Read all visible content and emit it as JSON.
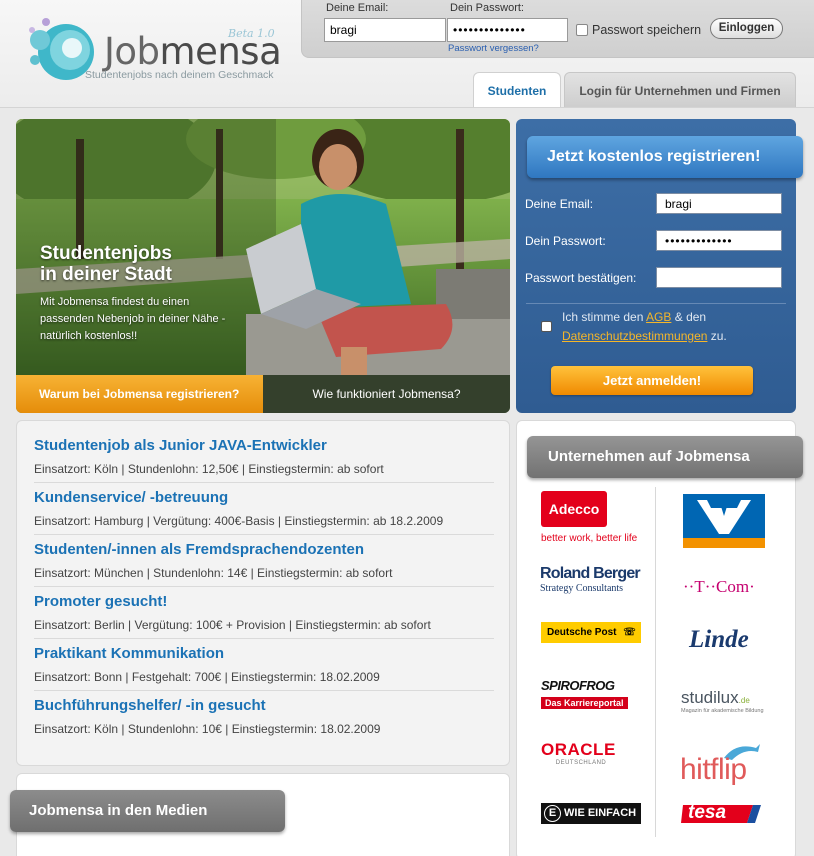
{
  "brand": {
    "name_part1": "Job",
    "name_part2": "mensa",
    "beta": "Beta 1.0",
    "tagline": "Studentenjobs nach deinem Geschmack"
  },
  "login": {
    "email_label": "Deine Email:",
    "email_value": "bragi",
    "password_label": "Dein Passwort:",
    "password_value": "••••••••••••••",
    "forgot": "Passwort vergessen?",
    "remember": "Passwort speichern",
    "submit": "Einloggen"
  },
  "tabs": [
    {
      "label": "Studenten",
      "active": true
    },
    {
      "label": "Login für Unternehmen und Firmen",
      "active": false
    }
  ],
  "hero": {
    "title_line1": "Studentenjobs",
    "title_line2": "in deiner Stadt",
    "text": "Mit Jobmensa findest du einen passenden Nebenjob in deiner Nähe - natürlich kostenlos!!",
    "btn_why": "Warum bei Jobmensa registrieren?",
    "btn_how": "Wie funktioniert Jobmensa?"
  },
  "register": {
    "banner": "Jetzt kostenlos registrieren!",
    "email_label": "Deine Email:",
    "email_value": "bragi",
    "password_label": "Dein Passwort:",
    "password_value": "•••••••••••••",
    "confirm_label": "Passwort bestätigen:",
    "confirm_value": "",
    "agree_pre": "Ich stimme den ",
    "agree_agb": "AGB",
    "agree_mid": " & den ",
    "agree_privacy": "Datenschutzbestimmungen",
    "agree_post": " zu.",
    "submit": "Jetzt anmelden!"
  },
  "jobs": [
    {
      "title": "Studentenjob als Junior JAVA-Entwickler",
      "meta": "Einsatzort: Köln | Stundenlohn: 12,50€ | Einstiegstermin: ab sofort"
    },
    {
      "title": "Kundenservice/ -betreuung",
      "meta": "Einsatzort: Hamburg | Vergütung: 400€-Basis | Einstiegstermin: ab 18.2.2009"
    },
    {
      "title": "Studenten/-innen als Fremdsprachendozenten",
      "meta": "Einsatzort: München | Stundenlohn: 14€ | Einstiegstermin: ab sofort"
    },
    {
      "title": "Promoter gesucht!",
      "meta": "Einsatzort: Berlin | Vergütung: 100€ + Provision | Einstiegstermin: ab sofort"
    },
    {
      "title": "Praktikant Kommunikation",
      "meta": "Einsatzort: Bonn | Festgehalt: 700€ | Einstiegstermin: 18.02.2009"
    },
    {
      "title": "Buchführungshelfer/ -in gesucht",
      "meta": "Einsatzort: Köln | Stundenlohn: 10€ | Einstiegstermin: 18.02.2009"
    }
  ],
  "media": {
    "banner": "Jobmensa in den Medien"
  },
  "companies": {
    "banner": "Unternehmen auf Jobmensa",
    "logos": {
      "adecco": "Adecco",
      "adecco_tag": "better work, better life",
      "volksbank": "Volksbank",
      "roland_berger": "Roland Berger",
      "roland_berger_tag": "Strategy Consultants",
      "tcom": "··T··Com·",
      "deutsche_post": "Deutsche Post",
      "linde": "Linde",
      "spirofrog": "SPIROFROG",
      "spirofrog_tag": "Das Karriereportal",
      "studilux": "studilux",
      "studilux_tld": ".de",
      "studilux_tag": "Magazin für akademische Bildung",
      "oracle": "ORACLE",
      "oracle_tag": "DEUTSCHLAND",
      "hitflip": "hitflip",
      "eplus": "WIE EINFACH",
      "tesa": "tesa"
    }
  }
}
